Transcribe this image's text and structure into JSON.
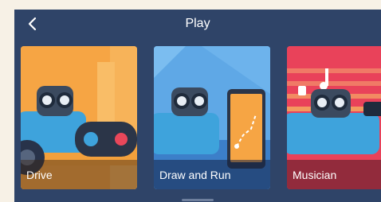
{
  "header": {
    "title": "Play",
    "back_icon": "chevron-left-icon"
  },
  "cards": [
    {
      "label": "Drive",
      "bg": "#f6a544"
    },
    {
      "label": "Draw and Run",
      "bg": "#5fa8e6"
    },
    {
      "label": "Musician",
      "bg": "#e9425a"
    }
  ],
  "colors": {
    "panel": "#2f4468",
    "robot_body": "#3ea3dc",
    "robot_face": "#1f2b3c"
  }
}
